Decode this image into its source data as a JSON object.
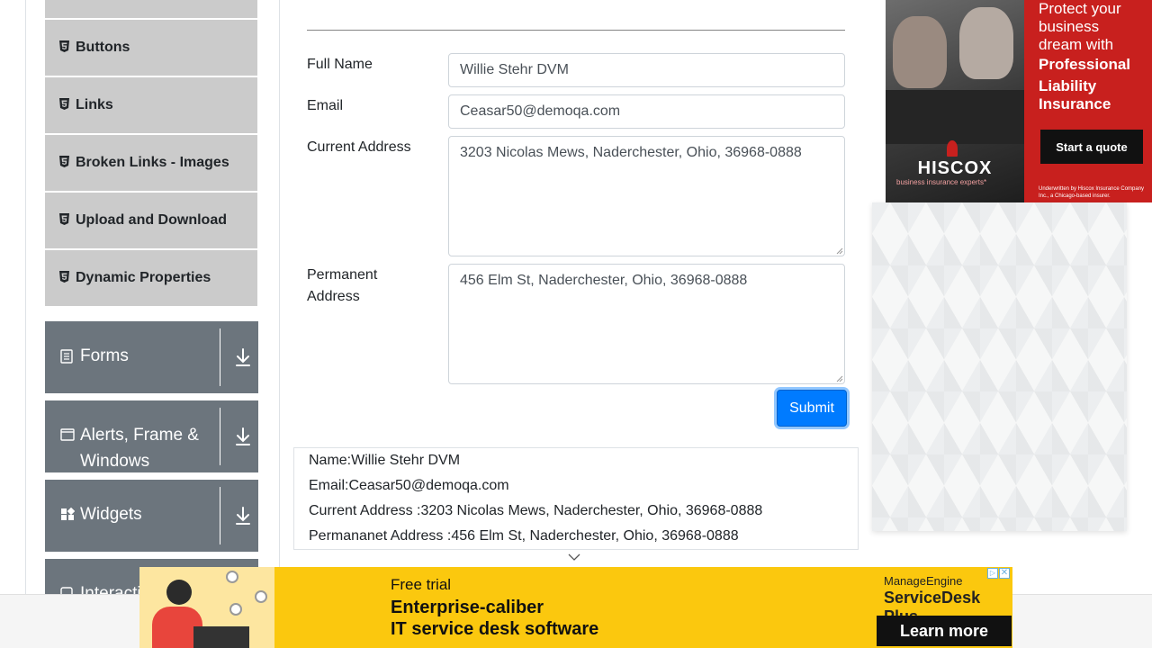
{
  "sidebar": {
    "sub_items": [
      {
        "label": "Buttons",
        "icon": "html5-icon"
      },
      {
        "label": "Links",
        "icon": "html5-icon"
      },
      {
        "label": "Broken Links - Images",
        "icon": "html5-icon"
      },
      {
        "label": "Upload and Download",
        "icon": "html5-icon"
      },
      {
        "label": "Dynamic Properties",
        "icon": "html5-icon"
      }
    ],
    "groups": [
      {
        "label": "Forms",
        "icon": "document-icon"
      },
      {
        "label": "Alerts, Frame &",
        "label_line2": "Windows",
        "icon": "window-icon"
      },
      {
        "label": "Widgets",
        "icon": "widgets-icon"
      },
      {
        "label": "Interactions",
        "icon": "interaction-icon"
      }
    ]
  },
  "form": {
    "full_name_label": "Full Name",
    "full_name_value": "Willie Stehr DVM",
    "email_label": "Email",
    "email_value": "Ceasar50@demoqa.com",
    "current_address_label": "Current Address",
    "current_address_value": "3203 Nicolas Mews, Naderchester, Ohio, 36968-0888",
    "permanent_address_label_1": "Permanent",
    "permanent_address_label_2": "Address",
    "permanent_address_value": "456 Elm St, Naderchester, Ohio, 36968-0888",
    "submit_label": "Submit"
  },
  "output": {
    "name": "Name:Willie Stehr DVM",
    "email": "Email:Ceasar50@demoqa.com",
    "current_address": "Current Address :3203 Nicolas Mews, Naderchester, Ohio, 36968-0888",
    "permanent_address": "Permananet Address :456 Elm St, Naderchester, Ohio, 36968-0888"
  },
  "ad_right": {
    "line1": "Protect your",
    "line2": "business",
    "line3": "dream with",
    "bold1": "Professional",
    "bold2": "Liability",
    "bold3": "Insurance",
    "cta": "Start a quote",
    "brand": "HISCOX",
    "tagline": "business insurance experts*",
    "fine_print": "Underwritten by Hiscox Insurance Company Inc., a Chicago-based insurer.",
    "brand_color": "#c8201e"
  },
  "ad_bottom": {
    "line1": "Free trial",
    "line2": "Enterprise-caliber",
    "line3": "IT service desk software",
    "brand1": "ManageEngine",
    "brand2": "ServiceDesk Plus",
    "cta": "Learn more",
    "bg_color": "#fbc80e"
  },
  "colors": {
    "primary": "#007bff",
    "sidebar_group": "#6c757d",
    "sidebar_item": "#cbcbcb"
  }
}
